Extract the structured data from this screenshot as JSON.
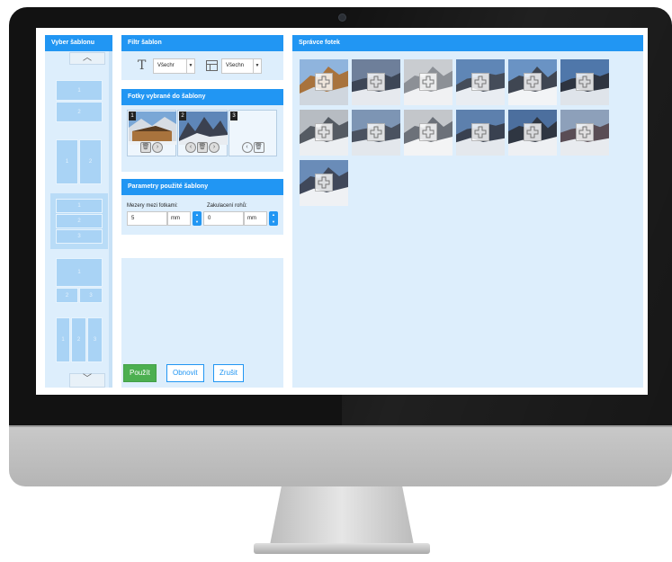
{
  "template_panel": {
    "title": "Vyber šablonu",
    "up_arrow": "︿",
    "down_arrow": "﹀",
    "templates": [
      {
        "cells": [
          "1",
          "2"
        ],
        "selected": false
      },
      {
        "cells": [
          "1",
          "2"
        ],
        "selected": false
      },
      {
        "cells": [
          "1",
          "2",
          "3"
        ],
        "selected": true
      },
      {
        "cells": [
          "1",
          "2",
          "3"
        ],
        "selected": false
      },
      {
        "cells": [
          "1",
          "2",
          "3"
        ],
        "selected": false
      }
    ]
  },
  "filter_panel": {
    "title": "Filtr šablon",
    "text_icon": "T",
    "select_1": "Všechr",
    "select_2": "Všechn"
  },
  "selected_photos_panel": {
    "title": "Fotky vybrané do šablony",
    "slots": [
      {
        "number": "1",
        "has_photo": true
      },
      {
        "number": "2",
        "has_photo": true
      },
      {
        "number": "3",
        "has_photo": false
      }
    ]
  },
  "params_panel": {
    "title": "Parametry použité šablony",
    "spacing_label": "Mezery mezi fotkami:",
    "spacing_value": "5",
    "spacing_unit": "mm",
    "corner_label": "Zakulacení rohů:",
    "corner_value": "0",
    "corner_unit": "mm"
  },
  "actions": {
    "apply": "Použít",
    "refresh": "Obnovit",
    "cancel": "Zrušit"
  },
  "photo_manager": {
    "title": "Správce fotek",
    "photo_count": 13
  },
  "colors": {
    "accent": "#2196f3",
    "panel_bg": "#ddeefc",
    "apply_green": "#4caf50"
  }
}
